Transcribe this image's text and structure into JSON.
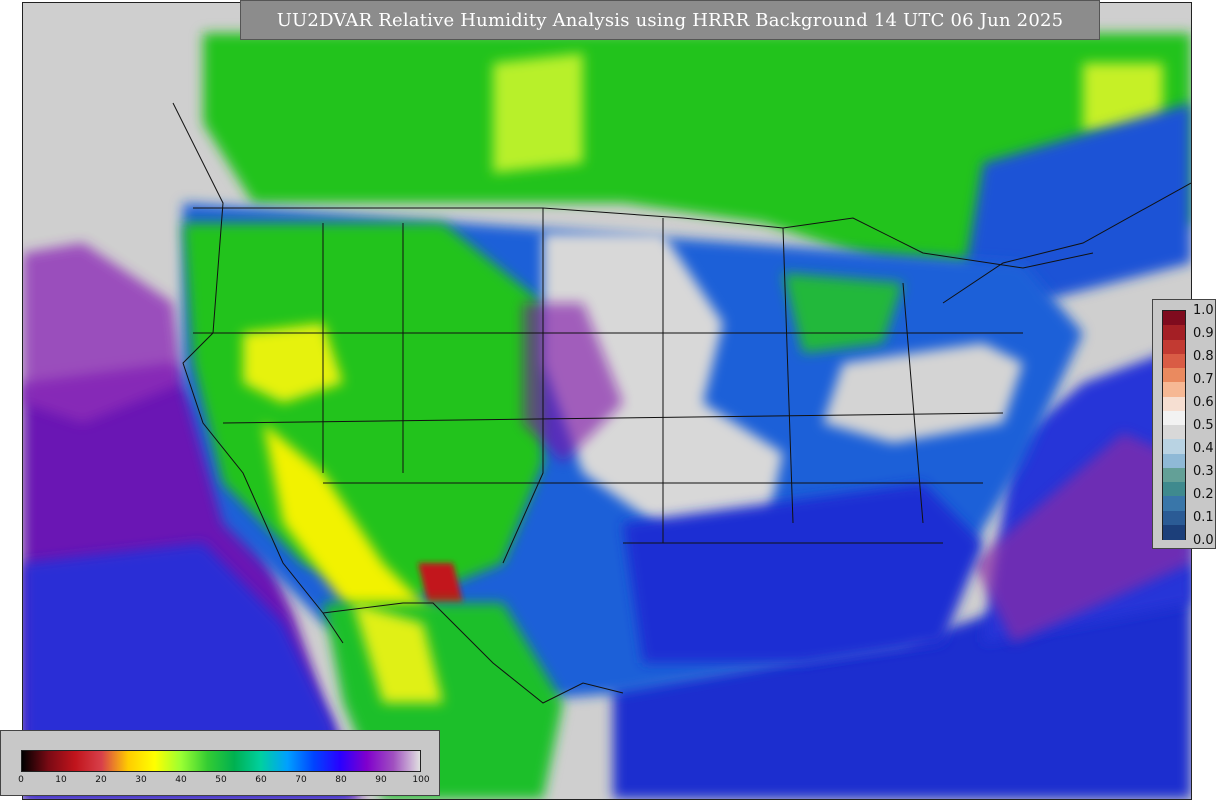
{
  "title": "UU2DVAR Relative Humidity Analysis using HRRR Background 14 UTC 06 Jun 2025",
  "colorbar": {
    "ticks": [
      "1.0",
      "0.9",
      "0.8",
      "0.7",
      "0.6",
      "0.5",
      "0.4",
      "0.3",
      "0.2",
      "0.1",
      "0.0"
    ],
    "colors": [
      "#7f0b1e",
      "#a41f25",
      "#c23a32",
      "#d95c45",
      "#ea8a5f",
      "#f6b894",
      "#f6dfd2",
      "#f2f2f2",
      "#d8d8d8",
      "#b9d3e3",
      "#8fb9d6",
      "#63a097",
      "#3f8a8e",
      "#3976a9",
      "#2b5b95",
      "#1c3f7a"
    ]
  },
  "legend": {
    "ticks": [
      "0",
      "10",
      "20",
      "30",
      "40",
      "50",
      "60",
      "70",
      "80",
      "90",
      "100"
    ],
    "stops": [
      "#000000",
      "#7a0a14",
      "#c0141c",
      "#d8404a",
      "#ffcc00",
      "#ffff00",
      "#99ff33",
      "#33cc33",
      "#00b050",
      "#00d0a0",
      "#00a0ff",
      "#0044ff",
      "#2a00ff",
      "#8000cc",
      "#a050c0",
      "#e0e0e0"
    ]
  },
  "map": {
    "background": "#cfcfcf",
    "ocean_color": "#1f2ecf",
    "land_green": "#22c31f",
    "dry_yellow": "#f2f200",
    "dry_red": "#c2191c",
    "moist_purple": "#7a0aa8",
    "saturated_gray": "#d6d6d6"
  }
}
